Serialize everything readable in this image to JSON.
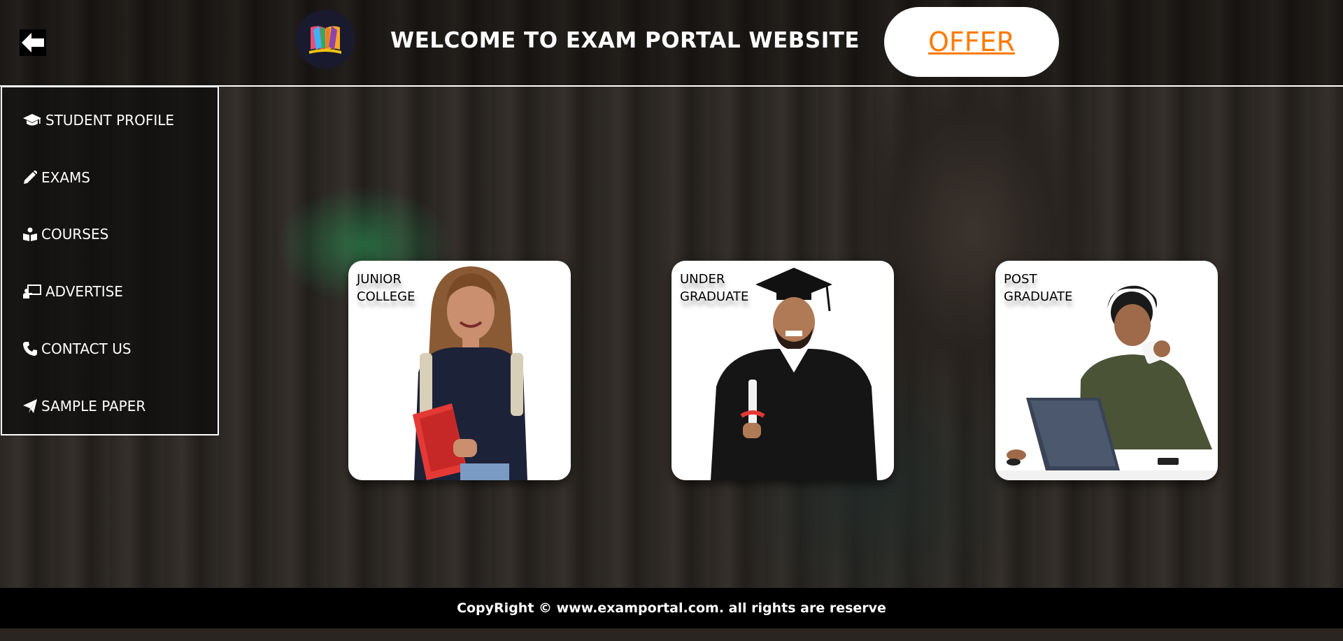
{
  "header": {
    "back_icon": "arrow-left-icon",
    "logo_icon": "books-logo-icon",
    "title": "WELCOME TO EXAM PORTAL WEBSITE",
    "offer_label": "OFFER",
    "offer_color": "#ff7a00"
  },
  "sidebar": {
    "items": [
      {
        "label": "STUDENT PROFILE",
        "icon": "graduation-cap-icon"
      },
      {
        "label": "EXAMS",
        "icon": "pencil-icon"
      },
      {
        "label": "COURSES",
        "icon": "book-reader-icon"
      },
      {
        "label": "ADVERTISE",
        "icon": "chalkboard-teacher-icon"
      },
      {
        "label": "CONTACT US",
        "icon": "phone-icon"
      },
      {
        "label": "SAMPLE PAPER",
        "icon": "paper-plane-icon"
      }
    ]
  },
  "cards": [
    {
      "line1": "JUNIOR",
      "line2": "COLLEGE"
    },
    {
      "line1": "UNDER",
      "line2": "GRADUATE"
    },
    {
      "line1": "POST",
      "line2": "GRADUATE"
    }
  ],
  "footer": {
    "copyright": "CopyRight © www.examportal.com. all rights are reserve"
  }
}
